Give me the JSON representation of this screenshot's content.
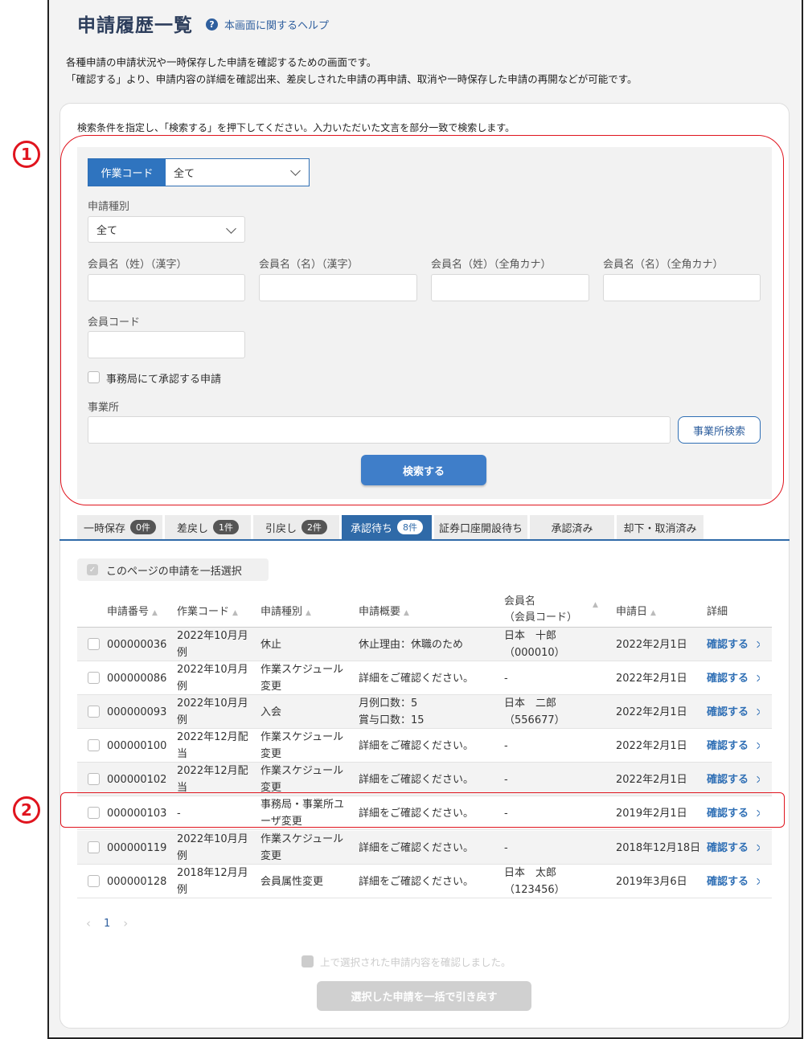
{
  "header": {
    "title": "申請履歴一覧",
    "help_icon": "?",
    "help_label": "本画面に関するヘルプ"
  },
  "description": [
    "各種申請の申請状況や一時保存した申請を確認するための画面です。",
    "「確認する」より、申請内容の詳細を確認出来、差戻しされた申請の再申請、取消や一時保存した申請の再開などが可能です。"
  ],
  "search": {
    "instruction": "検索条件を指定し、「検索する」を押下してください。入力いただいた文言を部分一致で検索します。",
    "work_code": {
      "label": "作業コード",
      "value": "全て"
    },
    "application_type": {
      "label": "申請種別",
      "value": "全て"
    },
    "name_fields": [
      {
        "label": "会員名（姓）（漢字）",
        "value": ""
      },
      {
        "label": "会員名（名）（漢字）",
        "value": ""
      },
      {
        "label": "会員名（姓）（全角カナ）",
        "value": ""
      },
      {
        "label": "会員名（名）（全角カナ）",
        "value": ""
      }
    ],
    "member_code": {
      "label": "会員コード",
      "value": ""
    },
    "office_approval_checkbox": {
      "label": "事務局にて承認する申請",
      "checked": false
    },
    "office": {
      "label": "事業所",
      "value": "",
      "search_button": "事業所検索"
    },
    "submit_label": "検索する"
  },
  "annotations": {
    "one": "1",
    "two": "2",
    "color": "#e0141e"
  },
  "tabs": [
    {
      "label": "一時保存",
      "badge": "0件",
      "active": false
    },
    {
      "label": "差戻し",
      "badge": "1件",
      "active": false
    },
    {
      "label": "引戻し",
      "badge": "2件",
      "active": false
    },
    {
      "label": "承認待ち",
      "badge": "8件",
      "active": true
    },
    {
      "label": "証券口座開設待ち",
      "badge": "",
      "active": false
    },
    {
      "label": "承認済み",
      "badge": "",
      "active": false
    },
    {
      "label": "却下・取消済み",
      "badge": "",
      "active": false
    }
  ],
  "bulk_select_label": "このページの申請を一括選択",
  "table": {
    "headers": {
      "number": "申請番号",
      "work_code": "作業コード",
      "type": "申請種別",
      "summary": "申請概要",
      "member_line1": "会員名",
      "member_line2": "（会員コード）",
      "date": "申請日",
      "detail": "詳細"
    },
    "confirm_label": "確認する",
    "rows": [
      {
        "number": "000000036",
        "code1": "2022年10月月",
        "code2": "例",
        "type1": "休止",
        "type2": "",
        "summary1": "休止理由：休職のため",
        "summary2": "",
        "member1": "日本　十郎",
        "member2": "（000010）",
        "date": "2022年2月1日"
      },
      {
        "number": "000000086",
        "code1": "2022年10月月",
        "code2": "例",
        "type1": "作業スケジュール",
        "type2": "変更",
        "summary1": "詳細をご確認ください。",
        "summary2": "",
        "member1": "-",
        "member2": "",
        "date": "2022年2月1日"
      },
      {
        "number": "000000093",
        "code1": "2022年10月月",
        "code2": "例",
        "type1": "入会",
        "type2": "",
        "summary1": "月例口数：5",
        "summary2": "賞与口数：15",
        "member1": "日本　二郎",
        "member2": "（556677）",
        "date": "2022年2月1日"
      },
      {
        "number": "000000100",
        "code1": "2022年12月配",
        "code2": "当",
        "type1": "作業スケジュール",
        "type2": "変更",
        "summary1": "詳細をご確認ください。",
        "summary2": "",
        "member1": "-",
        "member2": "",
        "date": "2022年2月1日"
      },
      {
        "number": "000000102",
        "code1": "2022年12月配",
        "code2": "当",
        "type1": "作業スケジュール",
        "type2": "変更",
        "summary1": "詳細をご確認ください。",
        "summary2": "",
        "member1": "-",
        "member2": "",
        "date": "2022年2月1日"
      },
      {
        "number": "000000103",
        "code1": "-",
        "code2": "",
        "type1": "事務局・事業所ユ",
        "type2": "ーザ変更",
        "summary1": "詳細をご確認ください。",
        "summary2": "",
        "member1": "-",
        "member2": "",
        "date": "2019年2月1日"
      },
      {
        "number": "000000119",
        "code1": "2022年10月月",
        "code2": "例",
        "type1": "作業スケジュール",
        "type2": "変更",
        "summary1": "詳細をご確認ください。",
        "summary2": "",
        "member1": "-",
        "member2": "",
        "date": "2018年12月18日"
      },
      {
        "number": "000000128",
        "code1": "2018年12月月",
        "code2": "例",
        "type1": "会員属性変更",
        "type2": "",
        "summary1": "詳細をご確認ください。",
        "summary2": "",
        "member1": "日本　太郎",
        "member2": "（123456）",
        "date": "2019年3月6日"
      }
    ]
  },
  "pagination": {
    "prev": "‹",
    "page": "1",
    "next": "›"
  },
  "confirm_checkbox_label": "上で選択された申請内容を確認しました。",
  "bulk_return_label": "選択した申請を一括で引き戻す"
}
